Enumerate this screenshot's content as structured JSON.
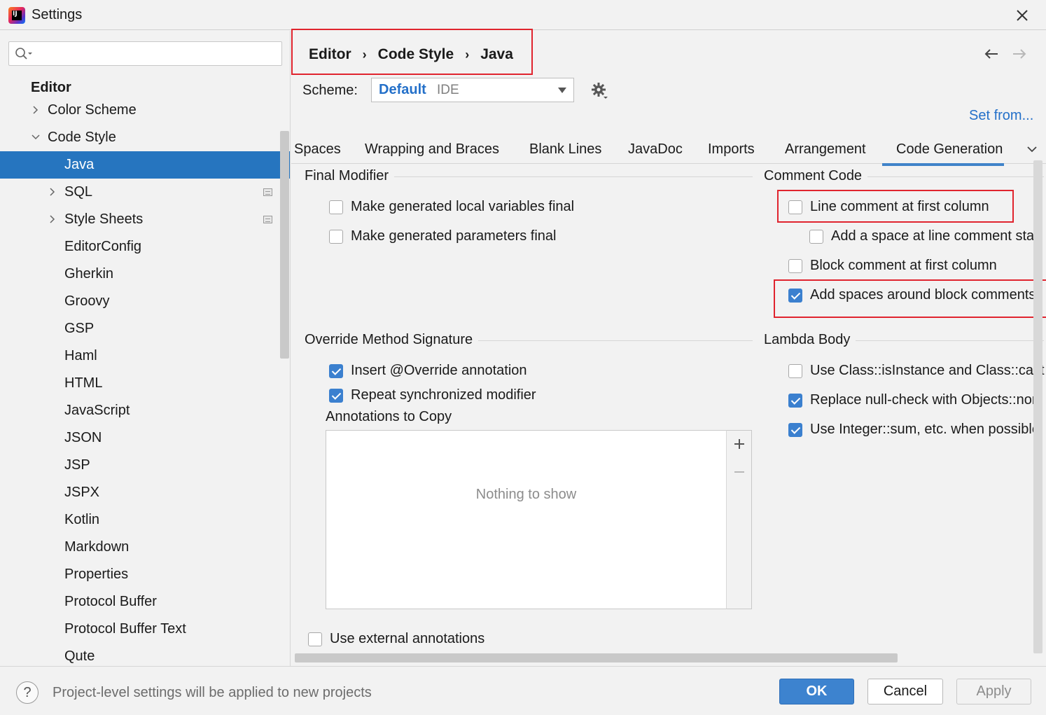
{
  "window": {
    "title": "Settings"
  },
  "search": {
    "value": "",
    "placeholder": ""
  },
  "sidebar": {
    "header": "Editor",
    "items": [
      {
        "label": "Color Scheme",
        "expandable": true,
        "expanded": false,
        "level": 1
      },
      {
        "label": "Code Style",
        "expandable": true,
        "expanded": true,
        "level": 1
      },
      {
        "label": "Java",
        "level": 2,
        "selected": true
      },
      {
        "label": "SQL",
        "expandable": true,
        "expanded": false,
        "level": 2,
        "badge": "project-icon"
      },
      {
        "label": "Style Sheets",
        "expandable": true,
        "expanded": false,
        "level": 2,
        "badge": "project-icon"
      },
      {
        "label": "EditorConfig",
        "level": 2
      },
      {
        "label": "Gherkin",
        "level": 2
      },
      {
        "label": "Groovy",
        "level": 2
      },
      {
        "label": "GSP",
        "level": 2
      },
      {
        "label": "Haml",
        "level": 2
      },
      {
        "label": "HTML",
        "level": 2
      },
      {
        "label": "JavaScript",
        "level": 2
      },
      {
        "label": "JSON",
        "level": 2
      },
      {
        "label": "JSP",
        "level": 2
      },
      {
        "label": "JSPX",
        "level": 2
      },
      {
        "label": "Kotlin",
        "level": 2
      },
      {
        "label": "Markdown",
        "level": 2
      },
      {
        "label": "Properties",
        "level": 2
      },
      {
        "label": "Protocol Buffer",
        "level": 2
      },
      {
        "label": "Protocol Buffer Text",
        "level": 2
      },
      {
        "label": "Qute",
        "level": 2
      }
    ]
  },
  "breadcrumb": {
    "items": [
      "Editor",
      "Code Style",
      "Java"
    ],
    "separator": "›"
  },
  "scheme": {
    "label": "Scheme:",
    "name": "Default",
    "scope": "IDE"
  },
  "set_from": "Set from...",
  "tabs": [
    {
      "label": "Spaces"
    },
    {
      "label": "Wrapping and Braces"
    },
    {
      "label": "Blank Lines"
    },
    {
      "label": "JavaDoc"
    },
    {
      "label": "Imports"
    },
    {
      "label": "Arrangement"
    },
    {
      "label": "Code Generation",
      "active": true
    }
  ],
  "final_modifier": {
    "title": "Final Modifier",
    "options": [
      {
        "label": "Make generated local variables final",
        "checked": false
      },
      {
        "label": "Make generated parameters final",
        "checked": false
      }
    ]
  },
  "comment_code": {
    "title": "Comment Code",
    "options": [
      {
        "label": "Line comment at first column",
        "checked": false
      },
      {
        "label": "Add a space at line comment star",
        "checked": false
      },
      {
        "label": "Block comment at first column",
        "checked": false
      },
      {
        "label": "Add spaces around block comments",
        "checked": true
      }
    ]
  },
  "override_method": {
    "title": "Override Method Signature",
    "options": [
      {
        "label": "Insert @Override annotation",
        "checked": true
      },
      {
        "label": "Repeat synchronized modifier",
        "checked": true
      }
    ],
    "annotations_label": "Annotations to Copy",
    "empty_text": "Nothing to show"
  },
  "lambda_body": {
    "title": "Lambda Body",
    "options": [
      {
        "label": "Use Class::isInstance and Class::cast",
        "checked": false
      },
      {
        "label": "Replace null-check with Objects::non",
        "checked": true
      },
      {
        "label": "Use Integer::sum, etc. when possible",
        "checked": true
      }
    ]
  },
  "external_annotations": {
    "label": "Use external annotations",
    "checked": false
  },
  "footer": {
    "help": "?",
    "message": "Project-level settings will be applied to new projects",
    "ok": "OK",
    "cancel": "Cancel",
    "apply": "Apply"
  },
  "colors": {
    "accent": "#2675bf",
    "link": "#2470c9",
    "highlight": "#e0242e",
    "checkbox": "#3b80cf"
  }
}
